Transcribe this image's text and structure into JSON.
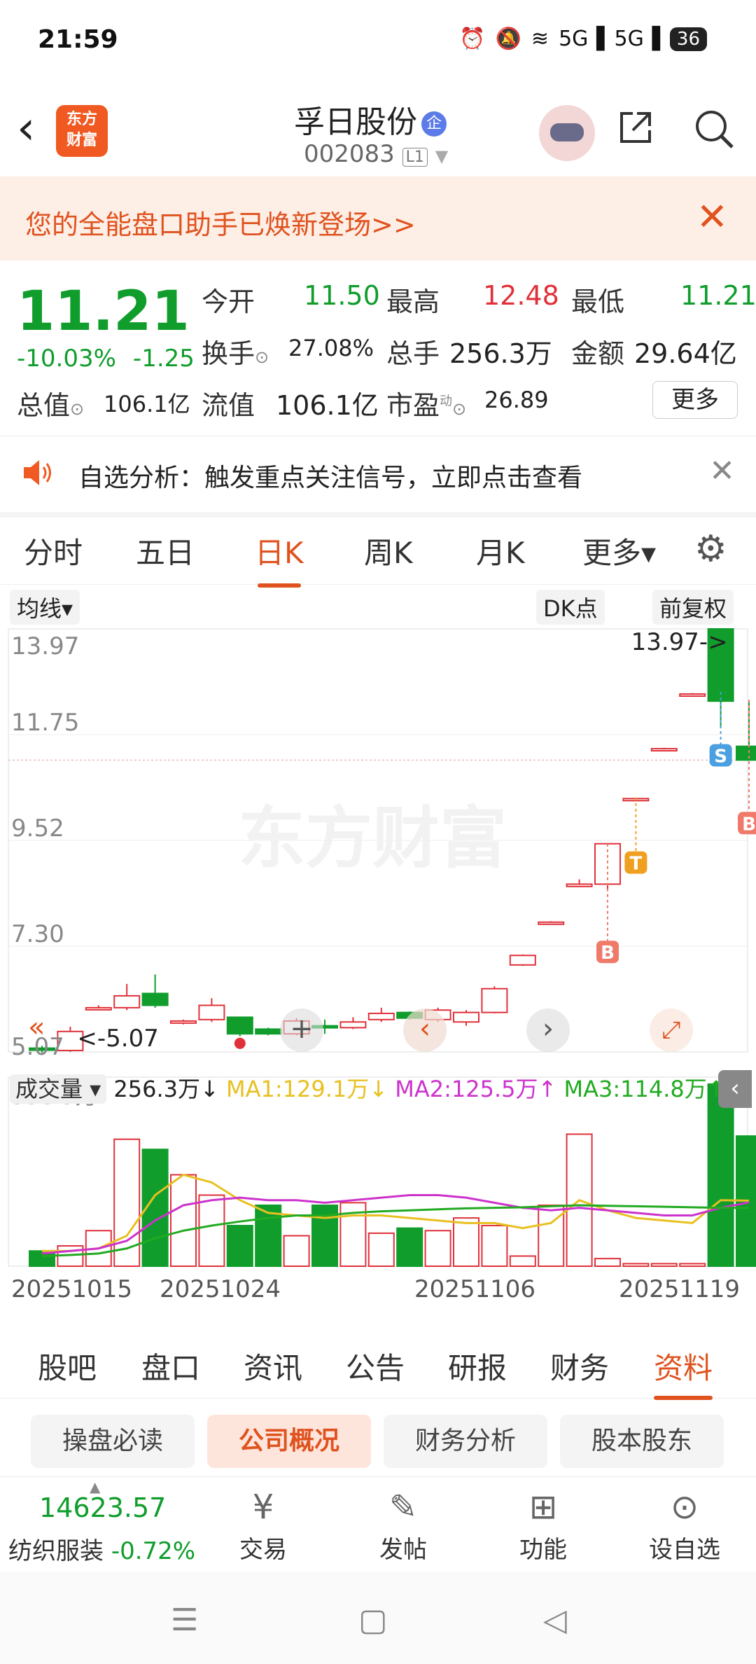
{
  "status": {
    "time": "21:59",
    "signal1": "5G",
    "signal2": "5G",
    "battery": "36"
  },
  "header": {
    "logo_line1": "东方",
    "logo_line2": "财富",
    "stock_name": "孚日股份",
    "badge": "企",
    "code": "002083",
    "level": "L1"
  },
  "banner": {
    "text": "您的全能盘口助手已焕新登场>>"
  },
  "quote": {
    "price": "11.21",
    "change_pct": "-10.03%",
    "change": "-1.25",
    "open_label": "今开",
    "open": "11.50",
    "high_label": "最高",
    "high": "12.48",
    "low_label": "最低",
    "low": "11.21",
    "turnover_label": "换手",
    "turnover": "27.08%",
    "volume_label": "总手",
    "volume": "256.3万",
    "amount_label": "金额",
    "amount": "29.64亿",
    "mktcap_label": "总值",
    "mktcap": "106.1亿",
    "float_label": "流值",
    "float": "106.1亿",
    "pe_label": "市盈",
    "pe_sup": "动",
    "pe": "26.89",
    "more": "更多"
  },
  "alert": {
    "text": "自选分析：触发重点关注信号，立即点击查看"
  },
  "tabs": [
    "分时",
    "五日",
    "日K",
    "周K",
    "月K",
    "更多▾"
  ],
  "chart_controls": {
    "ma": "均线▾",
    "dk": "DK点",
    "adjust": "前复权"
  },
  "volume_info": {
    "selector": "成交量 ▾",
    "vol": "256.3万↓",
    "ma1": "MA1:129.1万↓",
    "ma2": "MA2:125.5万↑",
    "ma3": "MA3:114.8万↑"
  },
  "colors": {
    "up": "#e0313a",
    "down": "#109d2c",
    "accent": "#e0521e",
    "ma1": "#e8c020",
    "ma2": "#cc33cc",
    "ma3": "#22aa22"
  },
  "chart_data": {
    "type": "candlestick",
    "y_ticks": [
      "13.97",
      "11.75",
      "9.52",
      "7.30",
      "5.07"
    ],
    "ylim": [
      5.07,
      13.97
    ],
    "max_label": "13.97->",
    "min_label": "<-5.07",
    "x_labels": [
      "20251015",
      "20251024",
      "20251106",
      "20251119"
    ],
    "candles": [
      {
        "o": 5.15,
        "c": 5.12,
        "h": 5.2,
        "l": 5.05
      },
      {
        "o": 5.1,
        "c": 5.5,
        "h": 5.6,
        "l": 5.07
      },
      {
        "o": 6.0,
        "c": 6.0,
        "h": 6.05,
        "l": 5.95
      },
      {
        "o": 6.0,
        "c": 6.25,
        "h": 6.5,
        "l": 5.95
      },
      {
        "o": 6.3,
        "c": 6.05,
        "h": 6.7,
        "l": 6.0
      },
      {
        "o": 5.7,
        "c": 5.72,
        "h": 5.75,
        "l": 5.65
      },
      {
        "o": 5.75,
        "c": 6.05,
        "h": 6.2,
        "l": 5.7
      },
      {
        "o": 5.8,
        "c": 5.45,
        "h": 5.8,
        "l": 5.4
      },
      {
        "o": 5.55,
        "c": 5.45,
        "h": 5.58,
        "l": 5.42
      },
      {
        "o": 5.45,
        "c": 5.72,
        "h": 5.78,
        "l": 5.42
      },
      {
        "o": 5.62,
        "c": 5.58,
        "h": 5.75,
        "l": 5.45
      },
      {
        "o": 5.58,
        "c": 5.7,
        "h": 5.8,
        "l": 5.55
      },
      {
        "o": 5.75,
        "c": 5.88,
        "h": 6.0,
        "l": 5.7
      },
      {
        "o": 5.9,
        "c": 5.78,
        "h": 5.92,
        "l": 5.75
      },
      {
        "o": 5.75,
        "c": 5.95,
        "h": 6.0,
        "l": 5.7
      },
      {
        "o": 5.7,
        "c": 5.9,
        "h": 5.95,
        "l": 5.62
      },
      {
        "o": 5.9,
        "c": 6.4,
        "h": 6.45,
        "l": 5.88
      },
      {
        "o": 6.9,
        "c": 7.1,
        "h": 7.12,
        "l": 6.88
      },
      {
        "o": 7.8,
        "c": 7.8,
        "h": 7.82,
        "l": 7.78
      },
      {
        "o": 8.55,
        "c": 8.6,
        "h": 8.7,
        "l": 8.55
      },
      {
        "o": 8.6,
        "c": 9.45,
        "h": 9.45,
        "l": 8.5
      },
      {
        "o": 10.4,
        "c": 10.4,
        "h": 10.42,
        "l": 10.38
      },
      {
        "o": 11.45,
        "c": 11.45,
        "h": 11.47,
        "l": 11.43
      },
      {
        "o": 12.6,
        "c": 12.6,
        "h": 12.62,
        "l": 12.58
      },
      {
        "o": 13.97,
        "c": 12.45,
        "h": 13.97,
        "l": 11.9
      },
      {
        "o": 11.5,
        "c": 11.21,
        "h": 12.48,
        "l": 11.21
      }
    ],
    "markers": [
      {
        "label": "B",
        "index": 20,
        "color": "#f07a6a"
      },
      {
        "label": "T",
        "index": 21,
        "color": "#f0a020"
      },
      {
        "label": "S",
        "index": 24,
        "color": "#4aa0e0"
      },
      {
        "label": "B",
        "index": 25,
        "color": "#f07a6a"
      }
    ],
    "volume": {
      "max_label": "358.5万",
      "values_wan": [
        30,
        40,
        70,
        250,
        230,
        180,
        140,
        80,
        120,
        60,
        120,
        125,
        65,
        75,
        70,
        95,
        80,
        20,
        120,
        260,
        15,
        5,
        5,
        5,
        358.5,
        256.3
      ],
      "ma1_wan": [
        30,
        30,
        35,
        60,
        140,
        180,
        165,
        130,
        105,
        100,
        95,
        100,
        100,
        95,
        90,
        85,
        85,
        75,
        85,
        130,
        110,
        95,
        90,
        85,
        130,
        129.1
      ],
      "ma2_wan": [
        25,
        30,
        35,
        50,
        90,
        120,
        130,
        135,
        130,
        130,
        125,
        130,
        135,
        140,
        140,
        135,
        125,
        115,
        110,
        115,
        110,
        105,
        100,
        100,
        115,
        125.5
      ],
      "ma3_wan": [
        20,
        22,
        25,
        35,
        55,
        70,
        80,
        88,
        95,
        100,
        100,
        105,
        108,
        110,
        112,
        114,
        115,
        116,
        118,
        120,
        119,
        118,
        117,
        116,
        115,
        114.8
      ]
    }
  },
  "bottom_tabs": [
    "股吧",
    "盘口",
    "资讯",
    "公告",
    "研报",
    "财务",
    "资料"
  ],
  "sub_tabs": [
    "操盘必读",
    "公司概况",
    "财务分析",
    "股本股东"
  ],
  "bottom_bar": {
    "index_value": "14623.57",
    "index_name": "纺织服装",
    "index_change": "-0.72%",
    "trade": "交易",
    "post": "发帖",
    "function": "功能",
    "watch": "设自选"
  }
}
